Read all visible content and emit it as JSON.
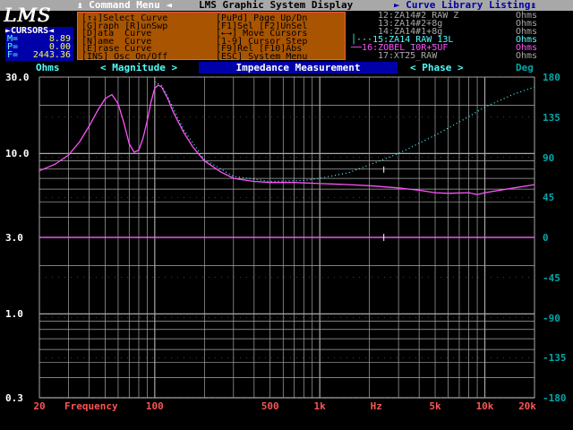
{
  "menubar": {
    "command_menu": "↨ Command Menu ◄",
    "title": "LMS Graphic System Display",
    "library": "► Curve Library Listing↨"
  },
  "logo": "LMS",
  "cursors": {
    "header": "►CURSORS◄",
    "m_label": "M=",
    "m_value": "8.89",
    "p_label": "P=",
    "p_value": "0.00",
    "f_label": "F=",
    "f_value": "2443.36"
  },
  "command_panel": {
    "rows": [
      [
        "[↑↓]Select Curve",
        "[PuPd] Page Up/Dn"
      ],
      [
        "[G]raph [R]unSwp",
        "[F1]Sel [F2]UnSel"
      ],
      [
        "[D]ata  Curve",
        "[←→] Move Cursors"
      ],
      [
        "[N]ame  Curve",
        "[1-9] Cursor Step"
      ],
      [
        "[E]rase Curve",
        "[F9]Rel [F10]Abs"
      ],
      [
        "[INS] Osc On/Off",
        "[ESC] System Menu"
      ]
    ]
  },
  "library": {
    "items": [
      {
        "name": "12:ZA14#2_RAW Z",
        "unit": "Ohms",
        "color": "#a8a8a8"
      },
      {
        "name": "13:ZA14#2+8g",
        "unit": "Ohms",
        "color": "#a8a8a8"
      },
      {
        "name": "14:ZA14#1+8g",
        "unit": "Ohms",
        "color": "#a8a8a8"
      },
      {
        "name": "15:ZA14_RAW_13L",
        "unit": "Ohms",
        "color": "#54fcfc",
        "marker": "│···"
      },
      {
        "name": "16:ZOBEL_10R+5UF",
        "unit": "Ohms",
        "color": "#fc54fc",
        "marker": "──"
      },
      {
        "name": "17:XT25_RAW",
        "unit": "Ohms",
        "color": "#a8a8a8"
      }
    ]
  },
  "titlebar": {
    "left_unit": "Ohms",
    "magnitude": "< Magnitude >",
    "title": "Impedance Measurement",
    "phase": "< Phase >",
    "right_unit": "Deg"
  },
  "colors": {
    "cursor_box": "#0000a8",
    "command_panel": "#a85400",
    "magenta_curve": "#fc54fc",
    "cyan_curve": "#54fcfc",
    "grid": "#a8a8a8",
    "axis_freq": "#fc5454",
    "axis_phase": "#00a8a8"
  },
  "chart_data": {
    "type": "line",
    "title": "Impedance Measurement",
    "xlabel": "Frequency",
    "ylabel": "Ohms",
    "y2label": "Deg",
    "x_scale": "log",
    "y_scale": "log",
    "xlim": [
      20,
      20000
    ],
    "ylim": [
      0.3,
      30.0
    ],
    "y2lim": [
      -180,
      180
    ],
    "x_tick_labels": [
      "20",
      "100",
      "500",
      "1k",
      "Hz",
      "5k",
      "10k",
      "20k"
    ],
    "x_tick_values": [
      20,
      100,
      500,
      1000,
      2200,
      5000,
      10000,
      20000
    ],
    "y_tick_labels": [
      "30.0",
      "10.0",
      "3.0",
      "1.0",
      "0.3"
    ],
    "y_tick_values": [
      30.0,
      10.0,
      3.0,
      1.0,
      0.3
    ],
    "y2_tick_labels": [
      "180",
      "135",
      "90",
      "45",
      "0",
      "-45",
      "-90",
      "-135",
      "-180"
    ],
    "y2_tick_values": [
      180,
      135,
      90,
      45,
      0,
      -45,
      -90,
      -135,
      -180
    ],
    "grid": true,
    "series": [
      {
        "name": "16:ZOBEL_10R+5UF",
        "axis": "magnitude",
        "color": "#fc54fc",
        "style": "solid",
        "points": [
          [
            20,
            7.8
          ],
          [
            25,
            8.6
          ],
          [
            30,
            9.8
          ],
          [
            35,
            11.8
          ],
          [
            40,
            14.8
          ],
          [
            45,
            18.5
          ],
          [
            50,
            22.0
          ],
          [
            55,
            23.3
          ],
          [
            60,
            20.5
          ],
          [
            65,
            15.5
          ],
          [
            70,
            11.5
          ],
          [
            75,
            10.2
          ],
          [
            80,
            10.5
          ],
          [
            85,
            12.5
          ],
          [
            90,
            16.0
          ],
          [
            95,
            21.0
          ],
          [
            100,
            25.5
          ],
          [
            105,
            26.7
          ],
          [
            110,
            26.0
          ],
          [
            120,
            22.0
          ],
          [
            130,
            18.0
          ],
          [
            150,
            13.5
          ],
          [
            170,
            11.0
          ],
          [
            200,
            9.0
          ],
          [
            250,
            7.7
          ],
          [
            300,
            7.0
          ],
          [
            400,
            6.7
          ],
          [
            500,
            6.6
          ],
          [
            700,
            6.6
          ],
          [
            1000,
            6.5
          ],
          [
            1500,
            6.4
          ],
          [
            2000,
            6.3
          ],
          [
            3000,
            6.1
          ],
          [
            4000,
            5.9
          ],
          [
            5000,
            5.7
          ],
          [
            6000,
            5.65
          ],
          [
            8000,
            5.7
          ],
          [
            9000,
            5.55
          ],
          [
            10000,
            5.7
          ],
          [
            15000,
            6.1
          ],
          [
            20000,
            6.4
          ]
        ]
      },
      {
        "name": "15:ZA14_RAW_13L",
        "axis": "magnitude",
        "color": "#54fcfc",
        "style": "dotted",
        "points": [
          [
            100,
            28.0
          ],
          [
            110,
            26.5
          ],
          [
            120,
            22.5
          ],
          [
            150,
            14.0
          ],
          [
            200,
            9.2
          ],
          [
            300,
            7.2
          ],
          [
            500,
            6.7
          ],
          [
            800,
            6.8
          ],
          [
            1000,
            7.0
          ],
          [
            1500,
            7.6
          ],
          [
            2000,
            8.5
          ],
          [
            3000,
            10.0
          ],
          [
            5000,
            13.0
          ],
          [
            8000,
            17.0
          ],
          [
            10000,
            19.5
          ],
          [
            15000,
            23.5
          ],
          [
            20000,
            26.0
          ]
        ]
      },
      {
        "name": "phase",
        "axis": "phase",
        "color": "#fc54fc",
        "style": "solid",
        "points": [
          [
            20,
            0
          ],
          [
            20000,
            0
          ]
        ]
      }
    ]
  }
}
